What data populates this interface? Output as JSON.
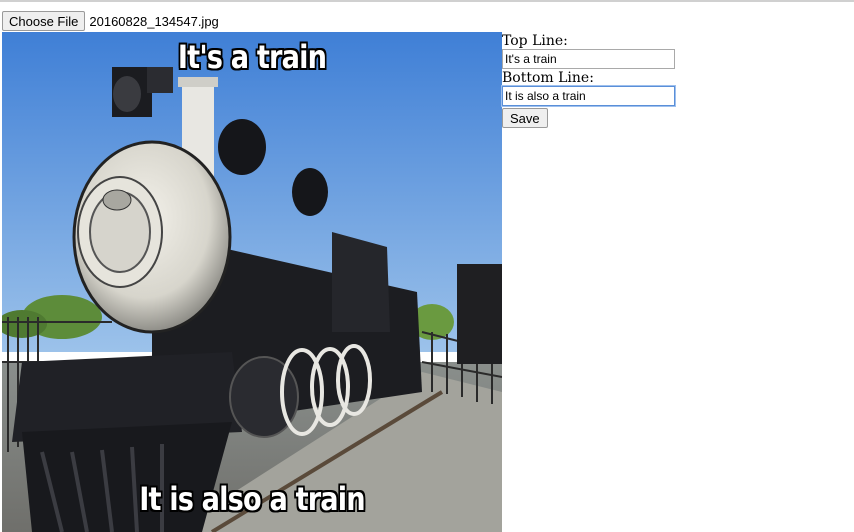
{
  "file_input": {
    "button_label": "Choose File",
    "file_name": "20160828_134547.jpg"
  },
  "meme": {
    "top_text": "It's a train",
    "bottom_text": "It is also a train"
  },
  "form": {
    "top_label": "Top Line:",
    "top_value": "It's a train",
    "bottom_label": "Bottom Line:",
    "bottom_value": "It is also a train",
    "save_label": "Save"
  }
}
